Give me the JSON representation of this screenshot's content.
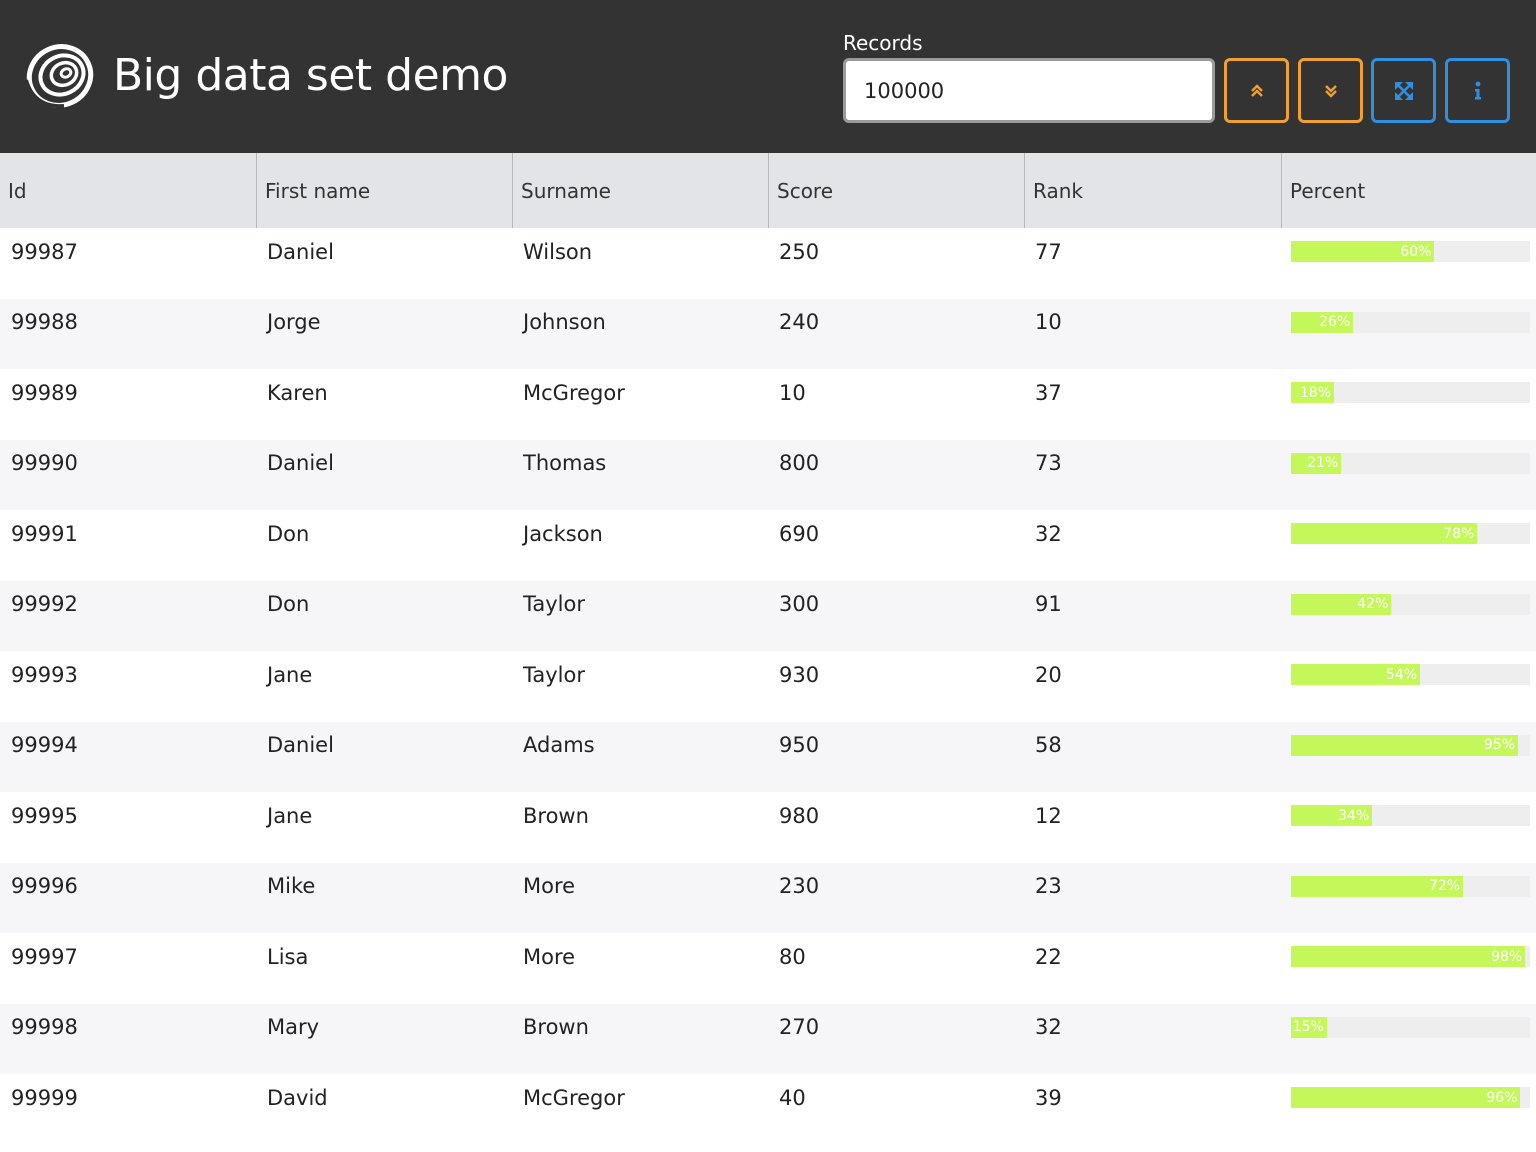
{
  "app": {
    "title": "Big data set demo",
    "logo_icon": "spiral-logo-icon"
  },
  "records": {
    "label": "Records",
    "value": "100000"
  },
  "toolbar": {
    "buttons": [
      {
        "icon": "double-chevron-up-icon",
        "color": "#f0a030"
      },
      {
        "icon": "double-chevron-down-icon",
        "color": "#f0a030"
      },
      {
        "icon": "expand-arrows-icon",
        "color": "#2f8fe0"
      },
      {
        "icon": "info-icon",
        "color": "#2f8fe0"
      }
    ]
  },
  "table": {
    "columns": [
      "Id",
      "First name",
      "Surname",
      "Score",
      "Rank",
      "Percent"
    ],
    "rows": [
      {
        "id": "99987",
        "first": "Daniel",
        "surname": "Wilson",
        "score": "250",
        "rank": "77",
        "percent": 60,
        "percent_label": "60%"
      },
      {
        "id": "99988",
        "first": "Jorge",
        "surname": "Johnson",
        "score": "240",
        "rank": "10",
        "percent": 26,
        "percent_label": "26%"
      },
      {
        "id": "99989",
        "first": "Karen",
        "surname": "McGregor",
        "score": "10",
        "rank": "37",
        "percent": 18,
        "percent_label": "18%"
      },
      {
        "id": "99990",
        "first": "Daniel",
        "surname": "Thomas",
        "score": "800",
        "rank": "73",
        "percent": 21,
        "percent_label": "21%"
      },
      {
        "id": "99991",
        "first": "Don",
        "surname": "Jackson",
        "score": "690",
        "rank": "32",
        "percent": 78,
        "percent_label": "78%"
      },
      {
        "id": "99992",
        "first": "Don",
        "surname": "Taylor",
        "score": "300",
        "rank": "91",
        "percent": 42,
        "percent_label": "42%"
      },
      {
        "id": "99993",
        "first": "Jane",
        "surname": "Taylor",
        "score": "930",
        "rank": "20",
        "percent": 54,
        "percent_label": "54%"
      },
      {
        "id": "99994",
        "first": "Daniel",
        "surname": "Adams",
        "score": "950",
        "rank": "58",
        "percent": 95,
        "percent_label": "95%"
      },
      {
        "id": "99995",
        "first": "Jane",
        "surname": "Brown",
        "score": "980",
        "rank": "12",
        "percent": 34,
        "percent_label": "34%"
      },
      {
        "id": "99996",
        "first": "Mike",
        "surname": "More",
        "score": "230",
        "rank": "23",
        "percent": 72,
        "percent_label": "72%"
      },
      {
        "id": "99997",
        "first": "Lisa",
        "surname": "More",
        "score": "80",
        "rank": "22",
        "percent": 98,
        "percent_label": "98%"
      },
      {
        "id": "99998",
        "first": "Mary",
        "surname": "Brown",
        "score": "270",
        "rank": "32",
        "percent": 15,
        "percent_label": "15%"
      },
      {
        "id": "99999",
        "first": "David",
        "surname": "McGregor",
        "score": "40",
        "rank": "39",
        "percent": 96,
        "percent_label": "96%"
      }
    ]
  },
  "colors": {
    "header_bg": "#333333",
    "table_head_bg": "#e3e4e8",
    "row_alt_bg": "#f6f6f8",
    "bar_fill": "#c4f75a",
    "bar_track": "#eeeeee"
  }
}
